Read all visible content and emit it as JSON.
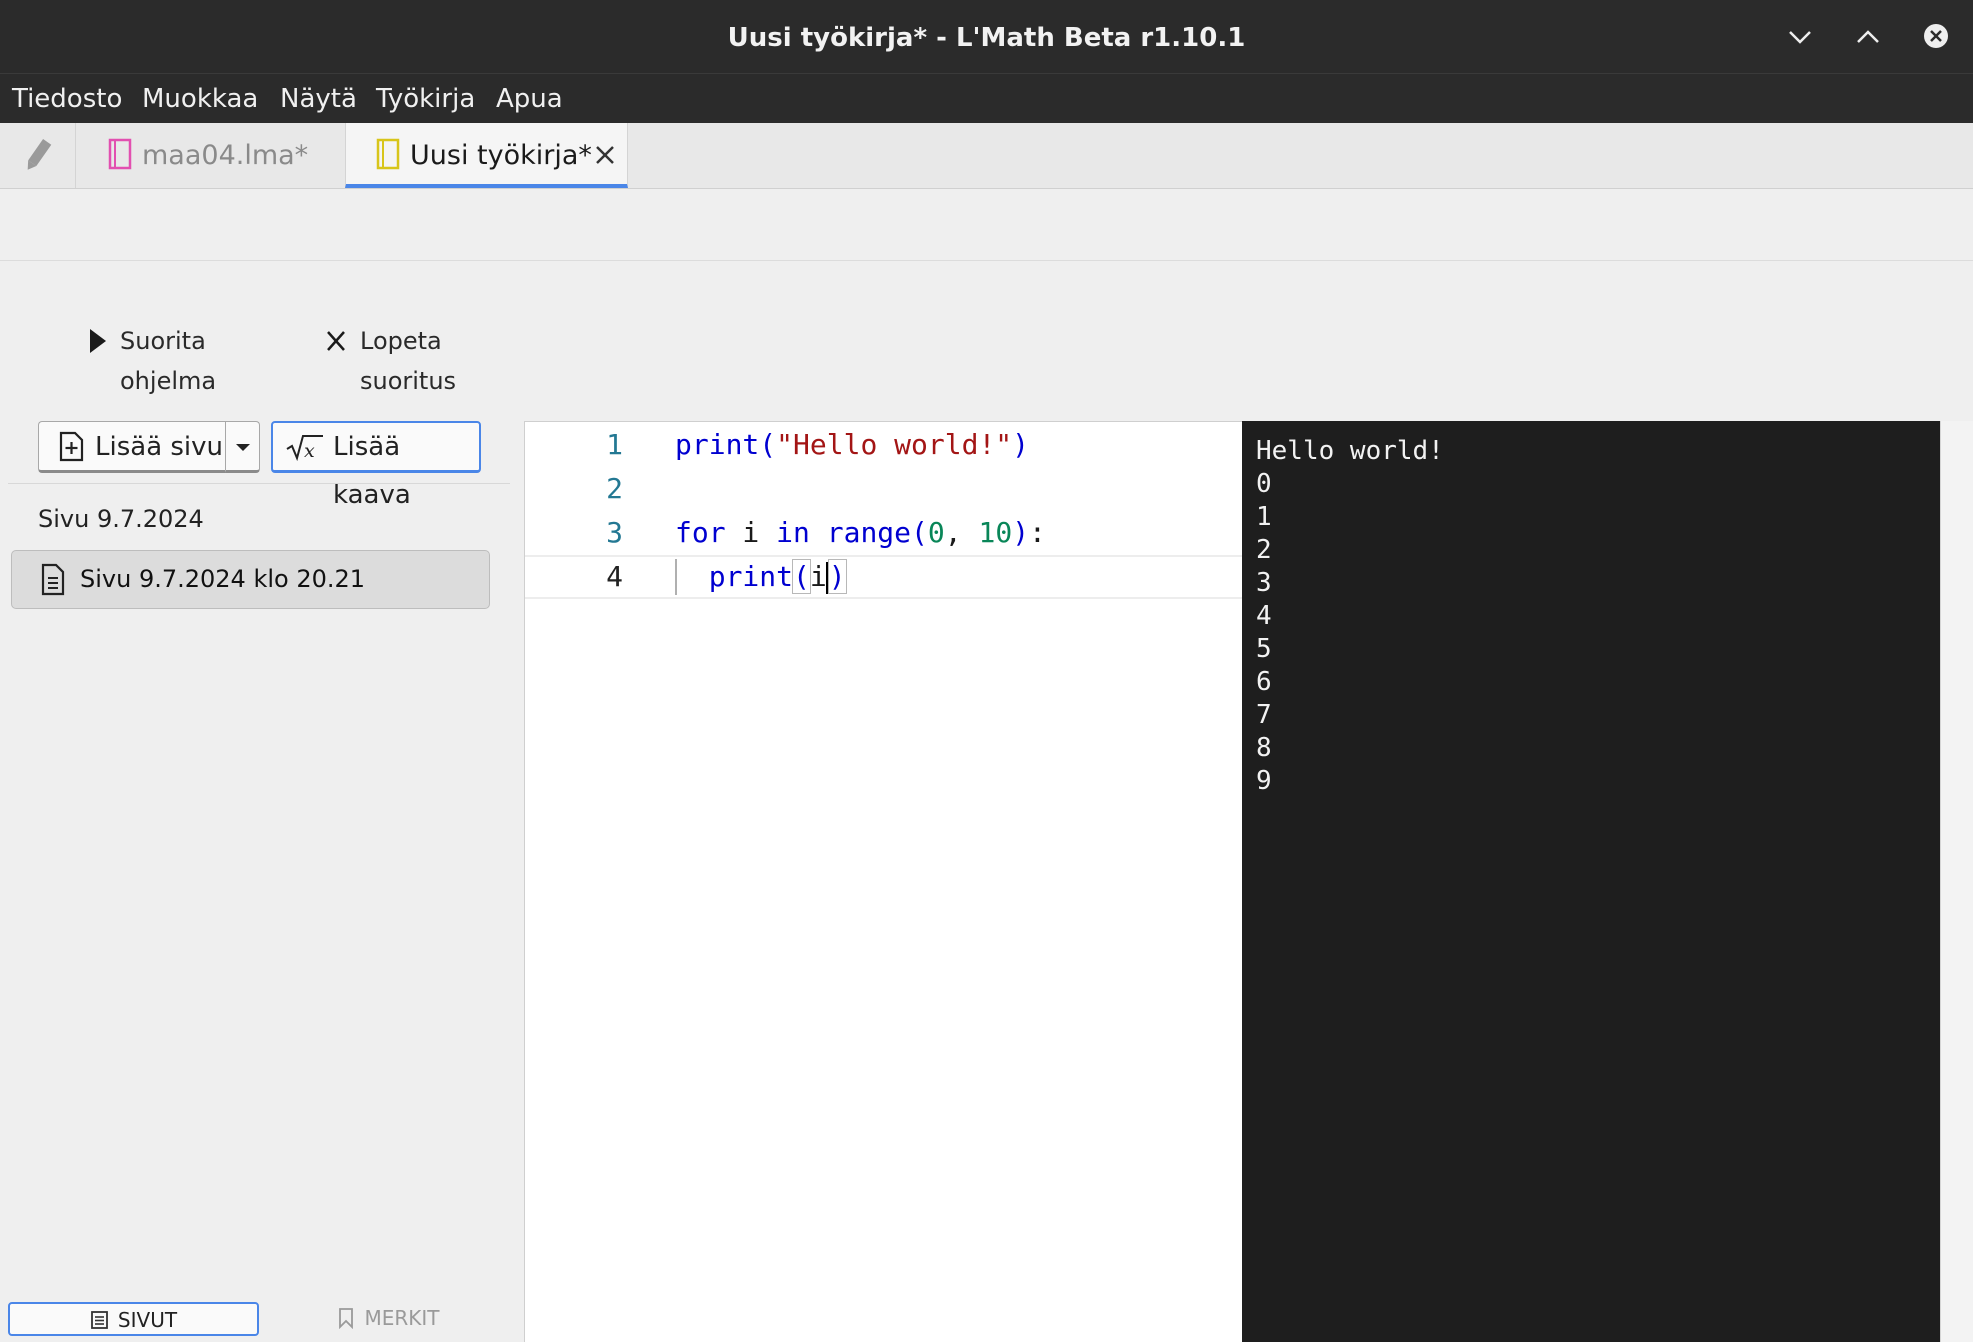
{
  "window": {
    "title": "Uusi työkirja* - L'Math Beta r1.10.1"
  },
  "menu": [
    "Tiedosto",
    "Muokkaa",
    "Näytä",
    "Työkirja",
    "Apua"
  ],
  "tabs": [
    {
      "label": "maa04.lma*"
    },
    {
      "label": "Uusi työkirja*",
      "active": true
    }
  ],
  "toolbar": {
    "run_label": "Suorita ohjelma",
    "stop_label": "Lopeta suoritus"
  },
  "sidebar": {
    "add_page_label": "Lisää sivu",
    "add_formula_label": "Lisää kaava",
    "group_title": "Sivu 9.7.2024",
    "pages": [
      {
        "label": "Sivu 9.7.2024 klo 20.21",
        "selected": true
      }
    ],
    "bottom_tabs": {
      "pages": "SIVUT",
      "bookmarks": "MERKIT"
    }
  },
  "editor": {
    "lines": [
      {
        "n": "1",
        "code": "print(\"Hello world!\")"
      },
      {
        "n": "2",
        "code": ""
      },
      {
        "n": "3",
        "code": "for i in range(0, 10):"
      },
      {
        "n": "4",
        "code": "  print(i)"
      }
    ]
  },
  "console": {
    "output": [
      "Hello world!",
      "0",
      "1",
      "2",
      "3",
      "4",
      "5",
      "6",
      "7",
      "8",
      "9"
    ]
  },
  "colors": {
    "accent": "#4a86e8",
    "titlebar": "#2b2b2b",
    "console_bg": "#1e1e1e",
    "keyword": "#0000d0",
    "string": "#a31515",
    "number": "#098658"
  }
}
